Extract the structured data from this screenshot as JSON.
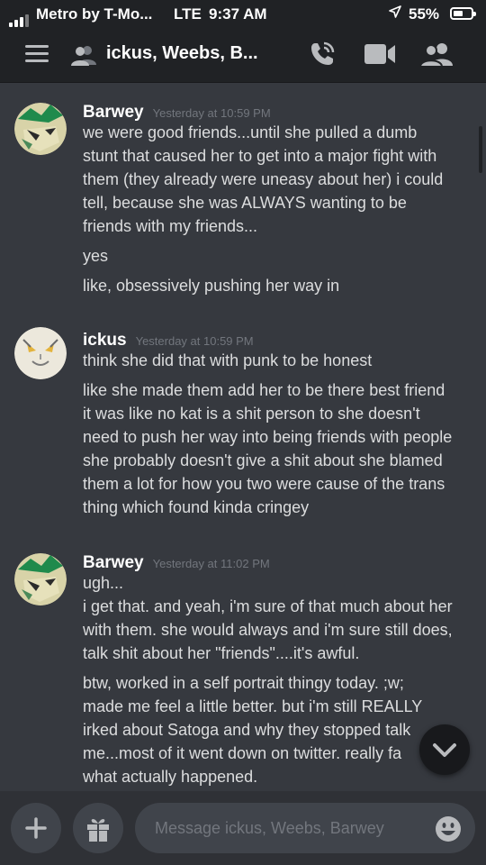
{
  "status_bar": {
    "carrier": "Metro by T-Mo...",
    "network": "LTE",
    "time": "9:37 AM",
    "battery": "55%",
    "battery_level": 0.55,
    "icons": [
      "signal-icon",
      "location-icon",
      "battery-icon"
    ]
  },
  "header": {
    "title": "ickus, Weebs, B...",
    "icons": [
      "hamburger-icon",
      "people-icon",
      "call-icon",
      "video-icon",
      "members-icon"
    ]
  },
  "messages": [
    {
      "author": "Barwey",
      "timestamp": "Yesterday at 10:59 PM",
      "lines": [
        "we were good friends...until she pulled a dumb",
        "stunt that caused her to get into a major fight with",
        "them (they already were uneasy about her) i could",
        "tell, because she was ALWAYS wanting to be",
        "friends with my friends...",
        "yes",
        "like, obsessively pushing her way in"
      ]
    },
    {
      "author": "ickus",
      "timestamp": "Yesterday at 10:59 PM",
      "lines": [
        "think she did that with punk to be honest",
        "like she made them add her to be there best friend",
        "it was like no kat is a shit person to she doesn't",
        "need to push her way into being friends with people",
        "she probably doesn't give a shit about she blamed",
        "them a lot for how you two were cause of the trans",
        "thing which found kinda cringey"
      ]
    },
    {
      "author": "Barwey",
      "timestamp": "Yesterday at 11:02 PM",
      "lines": [
        "ugh...",
        "i get that. and yeah, i'm sure of that much about her",
        "with them. she would always and i'm sure still does,",
        "talk shit about her \"friends\"....it's awful.",
        "btw, worked in a self portrait thingy today. ;w;",
        "made me feel a little better. but i'm still REALLY",
        "irked about Satoga and why they stopped talk",
        "me...most of it went down on twitter. really fa",
        "what actually happened."
      ]
    }
  ],
  "composer": {
    "placeholder": "Message ickus, Weebs, Barwey",
    "icons": [
      "plus-icon",
      "gift-icon",
      "emoji-icon"
    ]
  },
  "jump_to_bottom_icon": "chevron-down-icon",
  "colors": {
    "background": "#36393f",
    "header": "#202225",
    "composer": "#2f3136",
    "input": "#40444b",
    "timestamp": "#72767d",
    "text": "#dcddde"
  }
}
